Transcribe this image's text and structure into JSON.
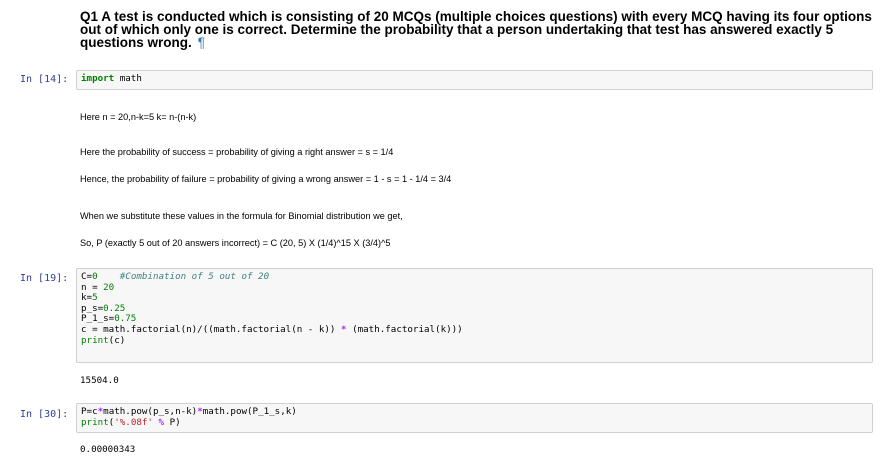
{
  "heading": {
    "text": "Q1 A test is conducted which is consisting of 20 MCQs (multiple choices questions) with every MCQ having its four options out of which only one is correct. Determine the probability that a person undertaking that test has answered exactly 5 questions wrong.",
    "pilcrow": "¶"
  },
  "cells": {
    "c14": {
      "prompt": "In [14]:",
      "code": [
        "import",
        " math"
      ]
    },
    "c19": {
      "prompt": "In [19]:",
      "lines": {
        "l1a": "C=",
        "l1b": "0",
        "l1c": "    #Combination of 5 out of 20",
        "l2a": "n = ",
        "l2b": "20",
        "l3a": "k=",
        "l3b": "5",
        "l4a": "p_s=",
        "l4b": "0.25",
        "l5a": "P_1_s=",
        "l5b": "0.75",
        "l6": "c = math.factorial(n)/((math.factorial(n - k)) ",
        "l6op": "*",
        "l6b": " (math.factorial(k)))",
        "l7a": "print",
        "l7b": "(c)"
      },
      "output": "15504.0"
    },
    "c30": {
      "prompt": "In [30]:",
      "lines": {
        "l1a": "P=c",
        "l1op": "*",
        "l1b": "math.pow(p_s,n-k)",
        "l1op2": "*",
        "l1c": "math.pow(P_1_s,k)",
        "l2a": "print",
        "l2b": "(",
        "l2str": "'%.08f'",
        "l2c": " ",
        "l2op": "%",
        "l2d": " P)"
      },
      "output": "0.00000343"
    }
  },
  "markdown": {
    "m1": "Here n = 20,n-k=5 k= n-(n-k)",
    "m2": "Here the probability of success = probability of giving a right answer = s = 1/4",
    "m3": "Hence, the probability of failure = probability of giving a wrong answer = 1 - s = 1 - 1/4 = 3/4",
    "m4": "When we substitute these values in the formula for Binomial distribution we get,",
    "m5": "So, P (exactly 5 out of 20 answers incorrect) = C (20, 5) X (1/4)^15 X (3/4)^5"
  }
}
